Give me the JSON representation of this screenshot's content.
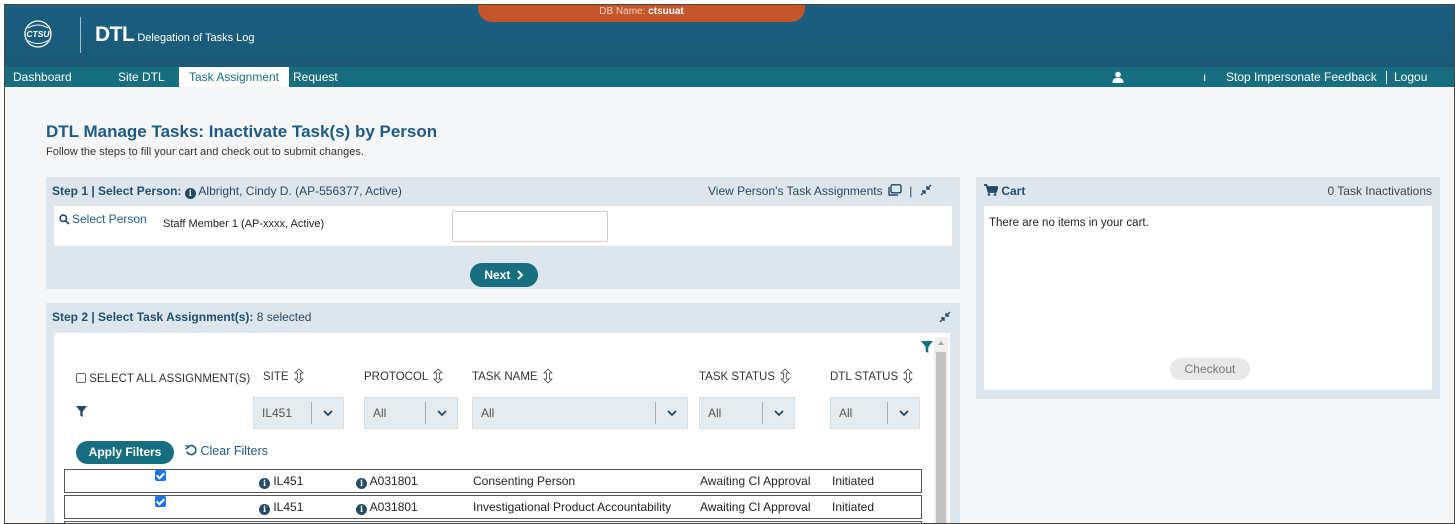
{
  "header": {
    "db_label": "DB Name: ",
    "db_name": "ctsuuat",
    "logo_text": "CTSU",
    "app_abbr": "DTL",
    "app_name": "Delegation of Tasks Log"
  },
  "nav": {
    "items": [
      "Dashboard",
      "Site DTL",
      "Task Assignment",
      "Request"
    ],
    "active": "Task Assignment",
    "user_stub": "ı",
    "stop_impersonate": "Stop Impersonate",
    "feedback": "Feedback",
    "logout": "Logou"
  },
  "page": {
    "title": "DTL Manage Tasks: Inactivate Task(s) by Person",
    "subtitle": "Follow the steps to fill your cart and check out to submit changes."
  },
  "step1": {
    "label": "Step 1 | Select Person:",
    "person": "Albright, Cindy D. (AP-556377, Active)",
    "view_link": "View Person's Task Assignments",
    "separator": "|",
    "select_label": "Select Person",
    "select_value": "Staff Member 1 (AP-xxxx, Active)",
    "next_button": "Next"
  },
  "step2": {
    "label": "Step 2 | Select Task Assignment(s):",
    "selected": "8 selected",
    "select_all": "SELECT ALL ASSIGNMENT(S)",
    "columns": [
      "SITE",
      "PROTOCOL",
      "TASK NAME",
      "TASK STATUS",
      "DTL STATUS"
    ],
    "filters": {
      "site": "IL451",
      "protocol": "All",
      "task_name": "All",
      "task_status": "All",
      "dtl_status": "All"
    },
    "apply_filters": "Apply Filters",
    "clear_filters": "Clear Filters",
    "rows": [
      {
        "site": "IL451",
        "protocol": "A031801",
        "task": "Consenting Person",
        "task_status": "Awaiting CI Approval",
        "dtl_status": "Initiated",
        "checked": true
      },
      {
        "site": "IL451",
        "protocol": "A031801",
        "task": "Investigational Product Accountability",
        "task_status": "Awaiting CI Approval",
        "dtl_status": "Initiated",
        "checked": true
      }
    ]
  },
  "cart": {
    "title": "Cart",
    "count": "0 Task Inactivations",
    "empty_message": "There are no items in your cart.",
    "checkout": "Checkout"
  },
  "colors": {
    "header_bg": "#1a5a78",
    "nav_bg": "#166e80",
    "accent": "#166e80",
    "db_tab": "#c5552a",
    "panel_bg": "#dde6ec",
    "title_blue": "#1e5b84"
  }
}
